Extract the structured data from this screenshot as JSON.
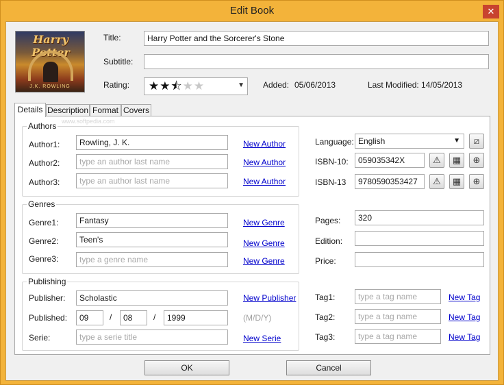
{
  "window": {
    "title": "Edit Book",
    "close_glyph": "✕"
  },
  "cover": {
    "text_title": "Harry Potter",
    "text_author": "J.K. ROWLING"
  },
  "header": {
    "title_label": "Title:",
    "title_value": "Harry Potter and the Sorcerer's Stone",
    "subtitle_label": "Subtitle:",
    "subtitle_value": "",
    "rating_label": "Rating:",
    "rating": {
      "value": 2.5,
      "max": 5
    },
    "added_label": "Added:",
    "added_value": "05/06/2013",
    "modified_label": "Last Modified:",
    "modified_value": "14/05/2013"
  },
  "tabs": [
    {
      "label": "Details",
      "active": true
    },
    {
      "label": "Description",
      "active": false
    },
    {
      "label": "Format",
      "active": false
    },
    {
      "label": "Covers",
      "active": false
    }
  ],
  "watermark": "www.softpedia.com",
  "authors": {
    "title": "Authors",
    "rows": [
      {
        "label": "Author1:",
        "value": "Rowling, J. K.",
        "placeholder": "type an author last name",
        "link": "New Author"
      },
      {
        "label": "Author2:",
        "value": "",
        "placeholder": "type an author last name",
        "link": "New Author"
      },
      {
        "label": "Author3:",
        "value": "",
        "placeholder": "type an author last name",
        "link": "New Author"
      }
    ]
  },
  "genres": {
    "title": "Genres",
    "rows": [
      {
        "label": "Genre1:",
        "value": "Fantasy",
        "placeholder": "type a genre name",
        "link": "New Genre"
      },
      {
        "label": "Genre2:",
        "value": "Teen's",
        "placeholder": "type a genre name",
        "link": "New Genre"
      },
      {
        "label": "Genre3:",
        "value": "",
        "placeholder": "type a genre name",
        "link": "New Genre"
      }
    ]
  },
  "publishing": {
    "title": "Publishing",
    "publisher_label": "Publisher:",
    "publisher_value": "Scholastic",
    "publisher_link": "New Publisher",
    "published_label": "Published:",
    "month": "09",
    "day": "08",
    "year": "1999",
    "sep": "/",
    "date_hint": "(M/D/Y)",
    "serie_label": "Serie:",
    "serie_value": "",
    "serie_placeholder": "type a serie title",
    "serie_link": "New Serie"
  },
  "right": {
    "language_label": "Language:",
    "language_value": "English",
    "isbn10_label": "ISBN-10:",
    "isbn10_value": "059035342X",
    "isbn13_label": "ISBN-13",
    "isbn13_value": "9780590353427",
    "pages_label": "Pages:",
    "pages_value": "320",
    "edition_label": "Edition:",
    "edition_value": "",
    "price_label": "Price:",
    "price_value": ""
  },
  "tags": [
    {
      "label": "Tag1:",
      "value": "",
      "placeholder": "type a tag name",
      "link": "New Tag"
    },
    {
      "label": "Tag2:",
      "value": "",
      "placeholder": "type a tag name",
      "link": "New Tag"
    },
    {
      "label": "Tag3:",
      "value": "",
      "placeholder": "type a tag name",
      "link": "New Tag"
    }
  ],
  "footer": {
    "ok_label": "OK",
    "cancel_label": "Cancel"
  },
  "icons": {
    "language_edit": "edit-language-icon",
    "warning": "warning-icon",
    "calculator": "calculator-icon",
    "download": "download-icon"
  }
}
